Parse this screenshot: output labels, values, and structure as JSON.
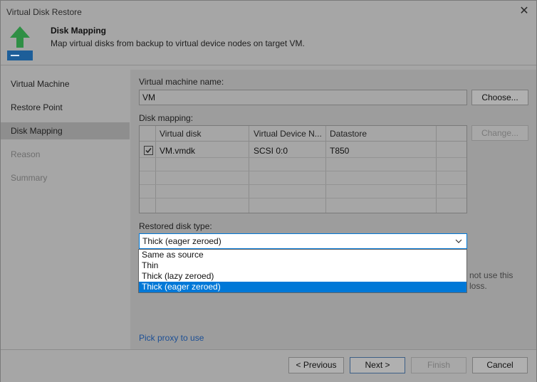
{
  "window": {
    "title": "Virtual Disk Restore"
  },
  "header": {
    "title": "Disk Mapping",
    "subtitle": "Map virtual disks from backup to virtual device nodes on target VM."
  },
  "sidebar": {
    "items": [
      {
        "label": "Virtual Machine",
        "state": "normal"
      },
      {
        "label": "Restore Point",
        "state": "normal"
      },
      {
        "label": "Disk Mapping",
        "state": "active"
      },
      {
        "label": "Reason",
        "state": "disabled"
      },
      {
        "label": "Summary",
        "state": "disabled"
      }
    ]
  },
  "main": {
    "vm_name_label": "Virtual machine name:",
    "vm_name_value": "VM",
    "choose_button": "Choose...",
    "disk_mapping_label": "Disk mapping:",
    "change_button": "Change...",
    "table": {
      "columns": [
        "Virtual disk",
        "Virtual Device N...",
        "Datastore"
      ],
      "rows": [
        {
          "checked": true,
          "virtual_disk": "VM.vmdk",
          "device_node": "SCSI 0:0",
          "datastore": "T850"
        }
      ]
    },
    "restored_disk_type_label": "Restored disk type:",
    "restored_disk_type_value": "Thick (eager zeroed)",
    "dropdown_options": [
      "Same as source",
      "Thin",
      "Thick (lazy zeroed)",
      "Thick (eager zeroed)"
    ],
    "dropdown_selected_index": 3,
    "bg_note_line1": "not use this",
    "bg_note_line2": "loss.",
    "pick_proxy_link": "Pick proxy to use"
  },
  "footer": {
    "previous": "< Previous",
    "next": "Next >",
    "finish": "Finish",
    "cancel": "Cancel"
  },
  "colors": {
    "accent": "#0078d7",
    "icon_green": "#2eaa4a",
    "icon_blue": "#1b6fb5"
  }
}
